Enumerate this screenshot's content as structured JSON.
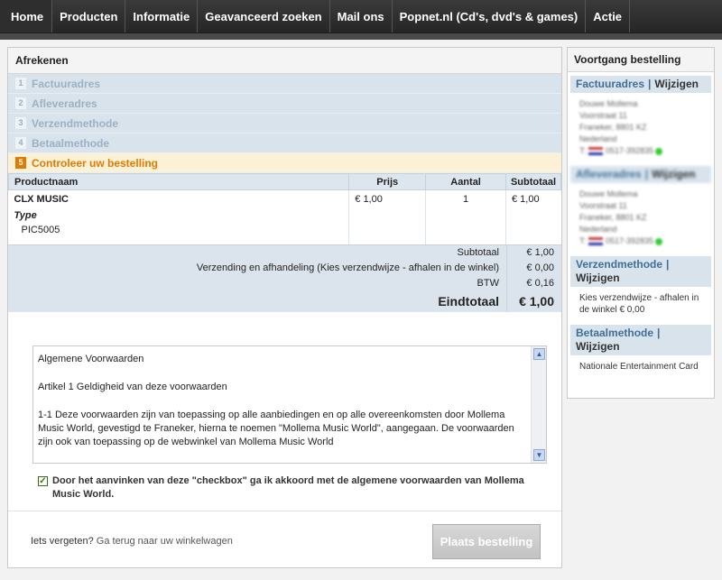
{
  "nav": {
    "items": [
      "Home",
      "Producten",
      "Informatie",
      "Geavanceerd zoeken",
      "Mail ons",
      "Popnet.nl (Cd's, dvd's & games)",
      "Actie"
    ]
  },
  "checkout": {
    "title": "Afrekenen",
    "steps": [
      {
        "num": "1",
        "label": "Factuuradres"
      },
      {
        "num": "2",
        "label": "Afleveradres"
      },
      {
        "num": "3",
        "label": "Verzendmethode"
      },
      {
        "num": "4",
        "label": "Betaalmethode"
      },
      {
        "num": "5",
        "label": "Controleer uw bestelling"
      }
    ],
    "table": {
      "headers": [
        "Productnaam",
        "Prijs",
        "Aantal",
        "Subtotaal"
      ],
      "row": {
        "name": "CLX MUSIC",
        "type_label": "Type",
        "type_value": "PIC5005",
        "price": "€ 1,00",
        "quantity": "1",
        "subtotal": "€ 1,00"
      }
    },
    "totals": [
      {
        "label": "Subtotaal",
        "value": "€ 1,00"
      },
      {
        "label": "Verzending en afhandeling (Kies verzendwijze - afhalen in de winkel)",
        "value": "€ 0,00"
      },
      {
        "label": "BTW",
        "value": "€ 0,16"
      }
    ],
    "grand_total": {
      "label": "Eindtotaal",
      "value": "€ 1,00"
    },
    "terms": {
      "title": "Algemene Voorwaarden",
      "article": "Artikel 1 Geldigheid van deze voorwaarden",
      "body": "1-1 Deze voorwaarden zijn van toepassing op alle aanbiedingen en op alle overeenkomsten door Mollema Music World, gevestigd te Franeker, hierna te noemen \"Mollema Music World\", aangegaan. De voorwaarden zijn ook van toepassing op de webwinkel van Mollema Music World"
    },
    "agree_checked": true,
    "agree_text": "Door het aanvinken van deze \"checkbox\" ga ik akkoord met de algemene voorwaarden van Mollema Music World.",
    "forgot_prefix": "Iets vergeten?",
    "back_link": "Ga terug naar uw winkelwagen",
    "place_order": "Plaats bestelling"
  },
  "sidebar": {
    "title": "Voortgang bestelling",
    "change_label": "Wijzigen",
    "billing": {
      "heading": "Factuuradres",
      "lines": [
        "Douwe Mollema",
        "Voorstraat 11",
        "Franeker, 8801 KZ",
        "Nederland"
      ],
      "phone": "0517-392835"
    },
    "delivery": {
      "heading": "Afleveradres",
      "lines": [
        "Douwe Mollema",
        "Voorstraat 11",
        "Franeker, 8801 KZ",
        "Nederland"
      ],
      "phone": "0517-392835"
    },
    "shipping": {
      "heading": "Verzendmethode",
      "value": "Kies verzendwijze - afhalen in de winkel € 0,00"
    },
    "payment": {
      "heading": "Betaalmethode",
      "value": "Nationale Entertainment Card"
    }
  }
}
